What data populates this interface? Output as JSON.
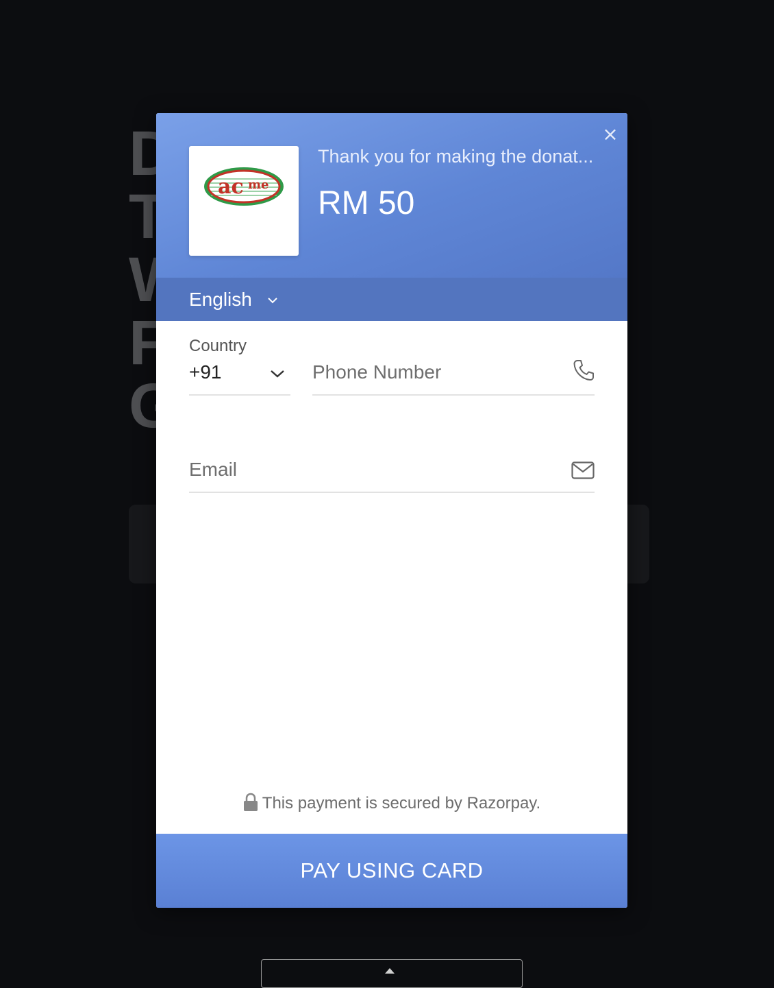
{
  "background": {
    "letters": [
      "D",
      "T",
      "W",
      "F",
      "G"
    ]
  },
  "modal": {
    "close_symbol": "×",
    "merchant": {
      "logo_text": "acme",
      "description": "Thank you for making the donat...",
      "amount": "RM 50"
    },
    "language": {
      "selected": "English"
    },
    "form": {
      "country": {
        "label": "Country",
        "value": "+91"
      },
      "phone": {
        "placeholder": "Phone Number",
        "value": ""
      },
      "email": {
        "placeholder": "Email",
        "value": ""
      }
    },
    "secure_text": "This payment is secured by Razorpay.",
    "pay_button_label": "PAY USING CARD"
  },
  "colors": {
    "header_gradient_start": "#7aa0e8",
    "header_gradient_end": "#5478c8",
    "language_bar": "#5375bf",
    "pay_button": "#5f88dc",
    "page_background": "#0c0d10"
  },
  "icons": {
    "close": "close-icon",
    "language_dropdown": "chevron-down-icon",
    "country_dropdown": "chevron-down-icon",
    "phone": "phone-icon",
    "email": "mail-icon",
    "secure": "lock-icon"
  }
}
